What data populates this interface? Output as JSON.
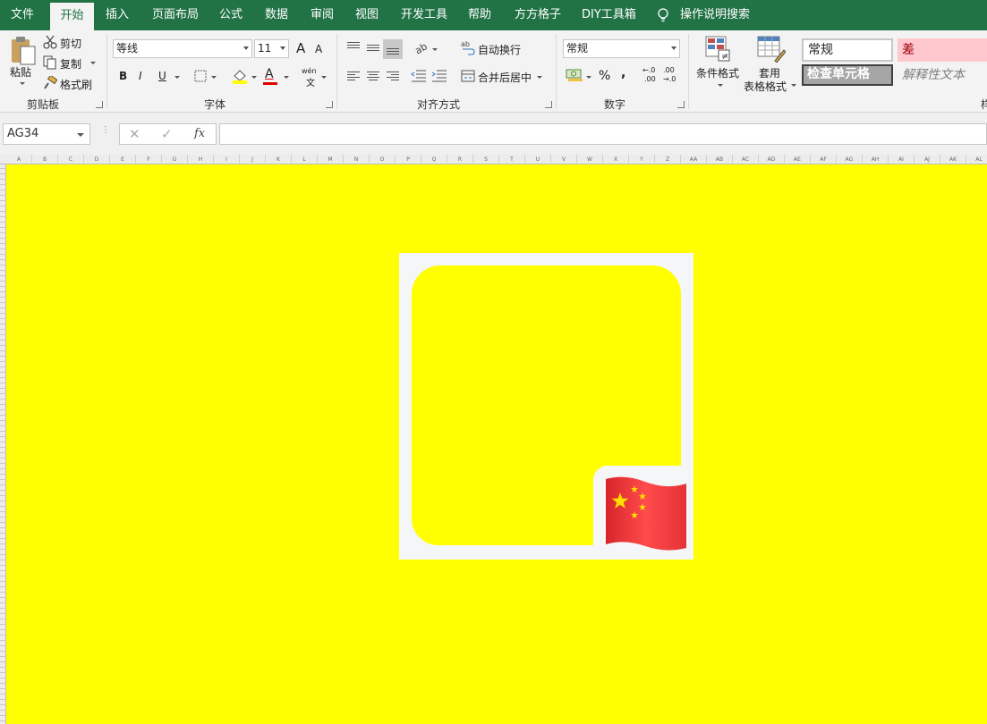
{
  "menu": {
    "tabs": [
      "文件",
      "开始",
      "插入",
      "页面布局",
      "公式",
      "数据",
      "审阅",
      "视图",
      "开发工具",
      "帮助",
      "方方格子",
      "DIY工具箱"
    ],
    "active": "开始",
    "tell_me": "操作说明搜索"
  },
  "ribbon": {
    "clipboard": {
      "paste": "粘贴",
      "cut": "剪切",
      "copy": "复制",
      "format_painter": "格式刷",
      "label": "剪贴板"
    },
    "font": {
      "name": "等线",
      "size": "11",
      "grow": "A",
      "shrink": "A",
      "bold": "B",
      "italic": "I",
      "underline": "U",
      "phonetic_top": "wén",
      "phonetic_bottom": "文",
      "label": "字体"
    },
    "alignment": {
      "wrap": "自动换行",
      "merge": "合并后居中",
      "label": "对齐方式"
    },
    "number": {
      "format": "常规",
      "percent": "%",
      "comma": ",",
      "inc_top": "←.0",
      "inc_bottom": ".00",
      "dec_top": ".00",
      "dec_bottom": "→.0",
      "label": "数字"
    },
    "styles": {
      "conditional": "条件格式",
      "table_format_1": "套用",
      "table_format_2": "表格格式",
      "normal": "常规",
      "bad": "差",
      "check": "检查单元格",
      "explanatory": "解释性文本",
      "label_partial": "样"
    }
  },
  "formula_bar": {
    "name_box": "AG34",
    "cancel": "✕",
    "enter": "✓",
    "fx": "fx",
    "formula": ""
  },
  "sheet": {
    "columns": [
      "A",
      "B",
      "C",
      "D",
      "E",
      "F",
      "G",
      "H",
      "I",
      "J",
      "K",
      "L",
      "M",
      "N",
      "O",
      "P",
      "Q",
      "R",
      "S",
      "T",
      "U",
      "V",
      "W",
      "X",
      "Y",
      "Z",
      "AA",
      "AB",
      "AC",
      "AD",
      "AE",
      "AF",
      "AG",
      "AH",
      "AI",
      "AJ",
      "AK",
      "AL"
    ],
    "background": "#ffff00"
  },
  "colors": {
    "ribbon_green": "#217346",
    "sheet_fill": "#ffff00",
    "frame": "#f5f6f8",
    "flag_red": "#e63a3a",
    "flag_star": "#ffde00",
    "bad_fill": "#ffc7ce",
    "bad_text": "#9c0006"
  }
}
